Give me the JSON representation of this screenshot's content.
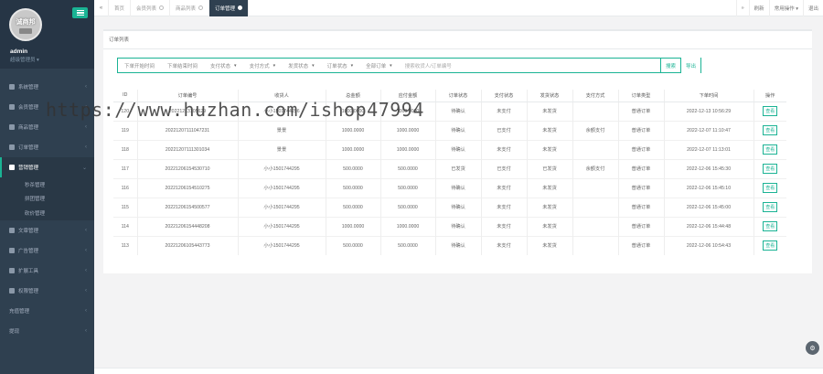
{
  "sidebar": {
    "logo_text": "诚商邦",
    "admin_name": "admin",
    "admin_role": "超级管理员 ▾",
    "items": [
      {
        "label": "系统管理",
        "icon": "gear-icon"
      },
      {
        "label": "会员管理",
        "icon": "user-icon"
      },
      {
        "label": "商品管理",
        "icon": "box-icon"
      },
      {
        "label": "订单管理",
        "icon": "cart-icon"
      },
      {
        "label": "营销管理",
        "icon": "tag-icon",
        "active": true
      }
    ],
    "sub_items": [
      "秒杀管理",
      "拼团管理",
      "砍价管理"
    ],
    "items_after": [
      {
        "label": "文章管理",
        "icon": "pencil-icon"
      },
      {
        "label": "广告管理",
        "icon": "image-icon"
      },
      {
        "label": "扩展工具",
        "icon": "tools-icon"
      },
      {
        "label": "权限管理",
        "icon": "person-icon"
      },
      {
        "label": "充值管理",
        "icon": "none"
      },
      {
        "label": "提现",
        "icon": "none"
      }
    ]
  },
  "topbar": {
    "tabs": [
      "首页",
      "会员列表",
      "商品列表",
      "订单管理"
    ],
    "active_tab": 3,
    "right": [
      "刷新",
      "常用操作 ▾",
      "退出"
    ]
  },
  "panel": {
    "title": "订单列表",
    "filters": [
      "下单开始时间",
      "下单结束时间",
      "支付状态",
      "支付方式",
      "发货状态",
      "订单状态",
      "全部订单"
    ],
    "search_placeholder": "搜索收货人/订单编号",
    "search_button": "搜索",
    "export_button": "导出"
  },
  "table": {
    "headers": [
      "ID",
      "订单编号",
      "收货人",
      "总金额",
      "应付金额",
      "订单状态",
      "支付状态",
      "发货状态",
      "支付方式",
      "订单类型",
      "下单时间",
      "操作"
    ],
    "rows": [
      [
        "120",
        "20221213105629",
        "小小1501744296",
        "1000.0000",
        "1000.0000",
        "待确认",
        "未支付",
        "未发货",
        "",
        "普通订单",
        "2022-12-13 10:56:29",
        "查看"
      ],
      [
        "119",
        "20221207111047231",
        "景景",
        "1000.0000",
        "1000.0000",
        "待确认",
        "已支付",
        "未发货",
        "余额支付",
        "普通订单",
        "2022-12-07 11:10:47",
        "查看"
      ],
      [
        "118",
        "20221207111301034",
        "景景",
        "1000.0000",
        "1000.0000",
        "待确认",
        "未支付",
        "未发货",
        "",
        "普通订单",
        "2022-12-07 11:13:01",
        "查看"
      ],
      [
        "117",
        "20221206154530710",
        "小小1501744295",
        "500.0000",
        "500.0000",
        "已发货",
        "已支付",
        "已发货",
        "余额支付",
        "普通订单",
        "2022-12-06 15:45:30",
        "查看"
      ],
      [
        "116",
        "20221206154510275",
        "小小1501744295",
        "500.0000",
        "500.0000",
        "待确认",
        "未支付",
        "未发货",
        "",
        "普通订单",
        "2022-12-06 15:45:10",
        "查看"
      ],
      [
        "115",
        "20221206154500577",
        "小小1501744295",
        "500.0000",
        "500.0000",
        "待确认",
        "未支付",
        "未发货",
        "",
        "普通订单",
        "2022-12-06 15:45:00",
        "查看"
      ],
      [
        "114",
        "20221206154448208",
        "小小1501744295",
        "1000.0000",
        "1000.0000",
        "待确认",
        "未支付",
        "未发货",
        "",
        "普通订单",
        "2022-12-06 15:44:48",
        "查看"
      ],
      [
        "113",
        "20221206105443773",
        "小小1501744295",
        "500.0000",
        "500.0000",
        "待确认",
        "未支付",
        "未发货",
        "",
        "普通订单",
        "2022-12-06 10:54:43",
        "查看"
      ]
    ]
  },
  "watermark": "https://www.huzhan.com/ishop47994",
  "colors": {
    "sidebar": "#2f4050",
    "accent": "#1ab394"
  }
}
